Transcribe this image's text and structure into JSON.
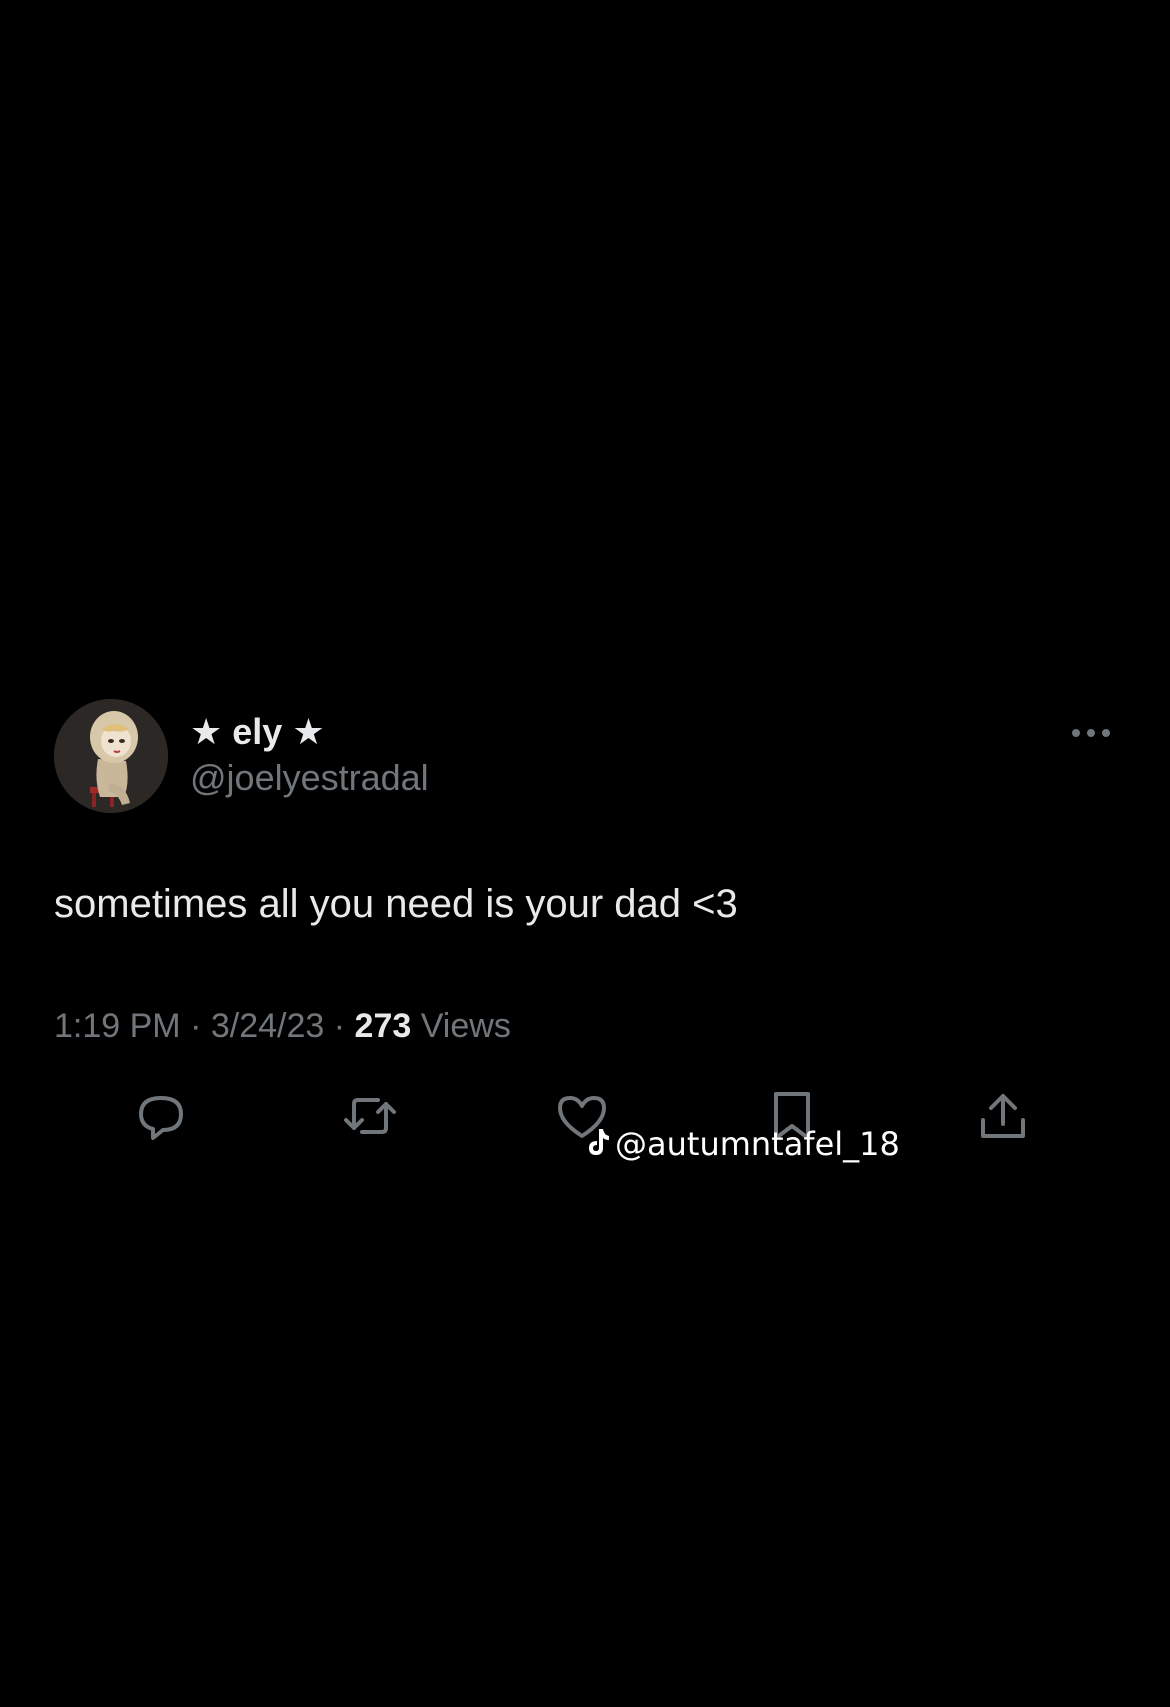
{
  "tweet": {
    "display_name": "★ ely ★",
    "handle": "@joelyestradal",
    "text": "sometimes all you need is your dad <3",
    "time": "1:19 PM",
    "date": "3/24/23",
    "views_count": "273",
    "views_label": "Views",
    "separator": "·"
  },
  "watermark": {
    "text": "@autumntafel_18",
    "icon": "tiktok-icon"
  },
  "icons": {
    "more": "more-dots-icon",
    "reply": "reply-icon",
    "retweet": "retweet-icon",
    "like": "like-icon",
    "bookmark": "bookmark-icon",
    "share": "share-icon"
  },
  "colors": {
    "background": "#000000",
    "primary_text": "#e7e9ea",
    "secondary_text": "#71767b",
    "icon": "#71767b"
  }
}
